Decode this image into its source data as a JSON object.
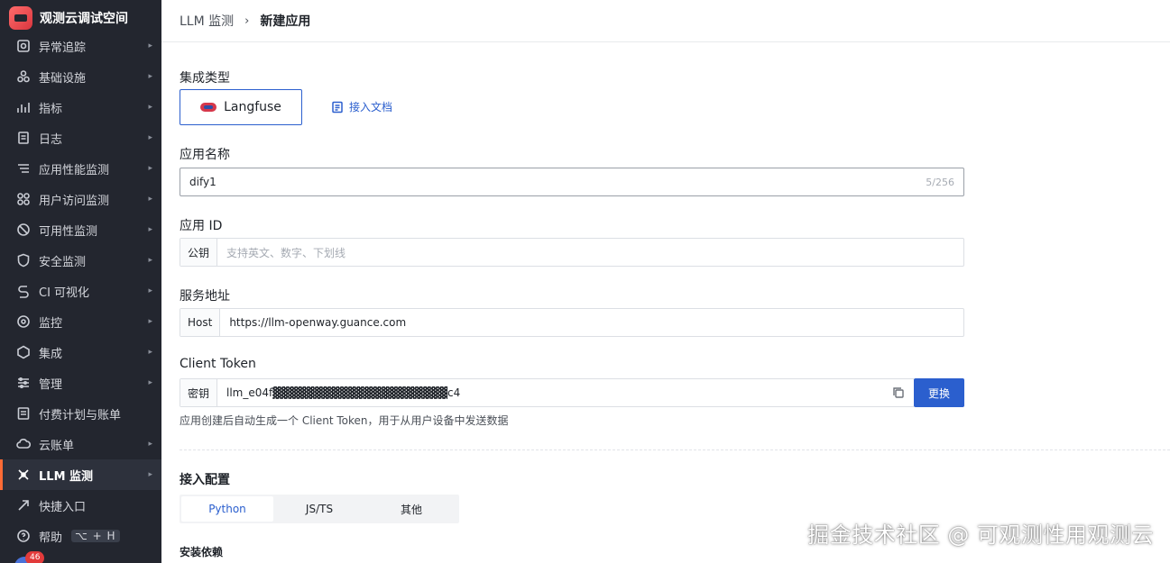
{
  "brand": {
    "name": "观测云调试空间",
    "logo": "guance-logo"
  },
  "sidebar": {
    "items": [
      {
        "label": "异常追踪",
        "icon": "incident-icon",
        "chevron": true
      },
      {
        "label": "基础设施",
        "icon": "infrastructure-icon",
        "chevron": true
      },
      {
        "label": "指标",
        "icon": "metrics-icon",
        "chevron": true
      },
      {
        "label": "日志",
        "icon": "logs-icon",
        "chevron": true
      },
      {
        "label": "应用性能监测",
        "icon": "apm-icon",
        "chevron": true
      },
      {
        "label": "用户访问监测",
        "icon": "rum-icon",
        "chevron": true
      },
      {
        "label": "可用性监测",
        "icon": "dialtest-icon",
        "chevron": true
      },
      {
        "label": "安全监测",
        "icon": "security-icon",
        "chevron": true
      },
      {
        "label": "CI 可视化",
        "icon": "ci-icon",
        "chevron": true
      },
      {
        "label": "监控",
        "icon": "monitor-icon",
        "chevron": true
      },
      {
        "label": "集成",
        "icon": "integration-icon",
        "chevron": true
      },
      {
        "label": "管理",
        "icon": "management-icon",
        "chevron": true
      },
      {
        "label": "付费计划与账单",
        "icon": "billing-icon",
        "chevron": false
      },
      {
        "label": "云账单",
        "icon": "cloud-billing-icon",
        "chevron": true
      },
      {
        "label": "LLM 监测",
        "icon": "llm-icon",
        "chevron": true,
        "active": true
      },
      {
        "label": "快捷入口",
        "icon": "shortcut-icon",
        "chevron": false
      },
      {
        "label": "帮助",
        "icon": "help-icon",
        "chevron": false,
        "shortcut": "⌥ + H"
      }
    ],
    "notification_count": "46",
    "accent_color": "#ff6b35"
  },
  "breadcrumb": {
    "parent": "LLM 监测",
    "current": "新建应用"
  },
  "form": {
    "integration_type": {
      "label": "集成类型",
      "selected": "Langfuse",
      "doc_link": "接入文档"
    },
    "app_name": {
      "label": "应用名称",
      "value": "dify1",
      "counter": "5/256"
    },
    "app_id": {
      "label": "应用 ID",
      "addon": "公钥",
      "placeholder": "支持英文、数字、下划线"
    },
    "service": {
      "label": "服务地址",
      "addon": "Host",
      "value": "https://llm-openway.guance.com"
    },
    "client_token": {
      "label": "Client Token",
      "addon": "密钥",
      "value": "llm_e04f▓▓▓▓▓▓▓▓▓▓▓▓▓▓▓▓▓▓▓▓▓c4",
      "button": "更换",
      "hint": "应用创建后自动生成一个 Client Token，用于从用户设备中发送数据"
    },
    "access_config": {
      "label": "接入配置",
      "tabs": [
        "Python",
        "JS/TS",
        "其他"
      ],
      "active_tab": "Python",
      "section": "安装依赖"
    }
  },
  "watermark": "掘金技术社区 @ 可观测性用观测云",
  "colors": {
    "primary": "#2b5fce",
    "sidebar_bg": "#23262f"
  }
}
